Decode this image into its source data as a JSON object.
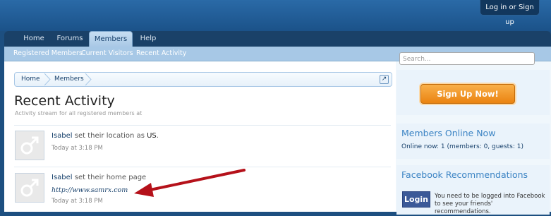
{
  "header": {
    "login_label": "Log in or Sign up"
  },
  "nav": {
    "tabs": [
      {
        "label": "Home"
      },
      {
        "label": "Forums"
      },
      {
        "label": "Members"
      },
      {
        "label": "Help"
      }
    ],
    "active_tab": "Members"
  },
  "subnav": {
    "links": [
      {
        "label": "Registered Members"
      },
      {
        "label": "Current Visitors"
      },
      {
        "label": "Recent Activity"
      }
    ]
  },
  "breadcrumb": [
    {
      "label": "Home"
    },
    {
      "label": "Members"
    }
  ],
  "main": {
    "title": "Recent Activity",
    "description": "Activity stream for all registered members at",
    "activities": [
      {
        "user": "Isabel",
        "text": "set their location as",
        "value": "US",
        "suffix": ".",
        "time": "Today at 3:18 PM"
      },
      {
        "user": "Isabel",
        "text": "set their home page",
        "link": "http://www.samrx.com",
        "time": "Today at 3:18 PM"
      }
    ]
  },
  "sidebar": {
    "search_placeholder": "Search...",
    "signup_label": "Sign Up Now!",
    "members_online_title": "Members Online Now",
    "members_online_text": "Online now: 1 (members: 0, guests: 1)",
    "facebook_title": "Facebook Recommendations",
    "facebook_login_label": "Login",
    "facebook_text": "You need to be logged into Facebook to see your friends' recommendations."
  },
  "colors": {
    "brand_blue": "#1d4f80",
    "link_blue": "#17406b",
    "signup_orange": "#ea8311",
    "annotation_arrow": "#b5111a"
  },
  "icons": {
    "avatar": "male-symbol-icon",
    "breadcrumb_jump": "external-arrow-icon"
  }
}
